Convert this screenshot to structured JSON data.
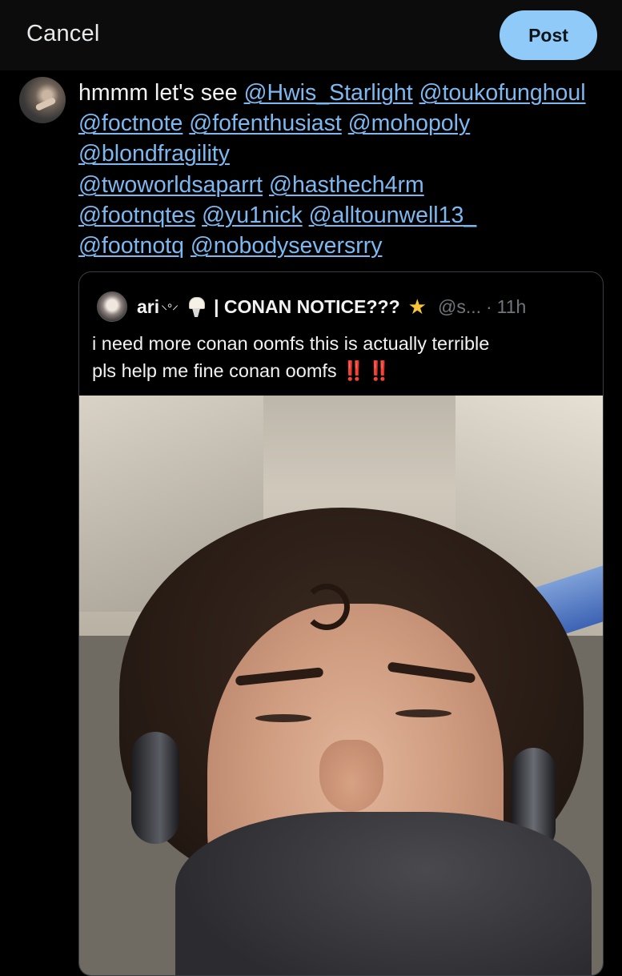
{
  "topbar": {
    "cancel_label": "Cancel",
    "post_label": "Post"
  },
  "compose": {
    "text_prefix": "hmmm let's see ",
    "mentions": [
      "@Hwis_Starlight",
      "@toukofunghoul",
      "@foctnote",
      "@fofenthusiast",
      "@mohopoly",
      "@blondfragility",
      "@twoworldsaparrt",
      "@hasthech4rm",
      "@footnqtes",
      "@yu1nick",
      "@alltounwell13_",
      "@footnotq",
      "@nobodyseversrry"
    ]
  },
  "quote": {
    "name": "ari",
    "name_deco": "⸜༚⸝",
    "title": "| CONAN NOTICE???",
    "handle": "@s...",
    "time": "11h",
    "body_line1": "i need more conan oomfs this is actually terrible",
    "body_line2": "pls help me fine conan oomfs",
    "emoji": "‼️ ‼️"
  },
  "colors": {
    "accent": "#1d9bf0",
    "post_button": "#8fcaf9",
    "mention": "#7db8f0",
    "background": "#000000"
  }
}
